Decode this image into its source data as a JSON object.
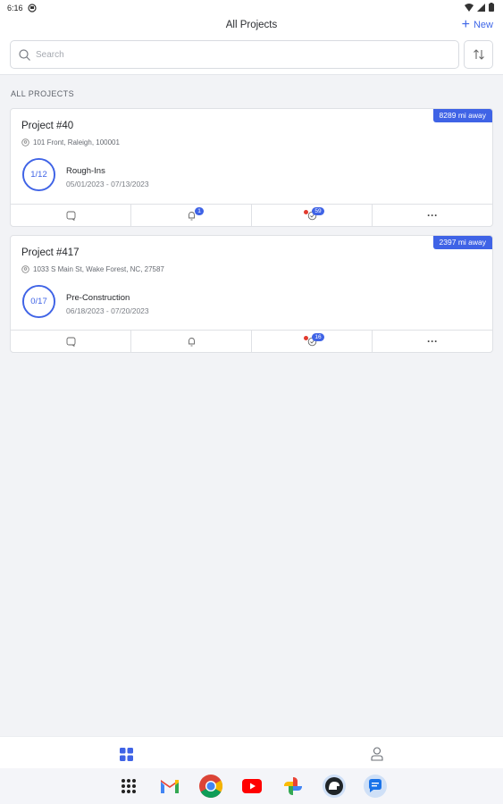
{
  "status_bar": {
    "time": "6:16"
  },
  "header": {
    "title": "All Projects",
    "new_label": "New"
  },
  "search": {
    "placeholder": "Search"
  },
  "section_label": "ALL PROJECTS",
  "projects": [
    {
      "name": "Project #40",
      "address": "101 Front, Raleigh, 100001",
      "distance": "8289 mi away",
      "progress_text": "1/12",
      "progress_fraction": 0.083,
      "phase": "Rough-Ins",
      "dates": "05/01/2023 - 07/13/2023",
      "notifications_count": "1",
      "tasks_count": "59"
    },
    {
      "name": "Project #417",
      "address": "1033 S Main St, Wake Forest, NC, 27587",
      "distance": "2397 mi away",
      "progress_text": "0/17",
      "progress_fraction": 0.0,
      "phase": "Pre-Construction",
      "dates": "06/18/2023 - 07/20/2023",
      "notifications_count": "",
      "tasks_count": "16"
    }
  ],
  "colors": {
    "accent": "#3f63e6",
    "alert": "#e23b2e"
  },
  "bottom_nav": [
    "projects-grid-icon",
    "profile-icon"
  ],
  "taskbar_apps": [
    "app-drawer-icon",
    "gmail-icon",
    "chrome-icon",
    "youtube-icon",
    "photos-icon",
    "app-icon",
    "messages-icon"
  ]
}
